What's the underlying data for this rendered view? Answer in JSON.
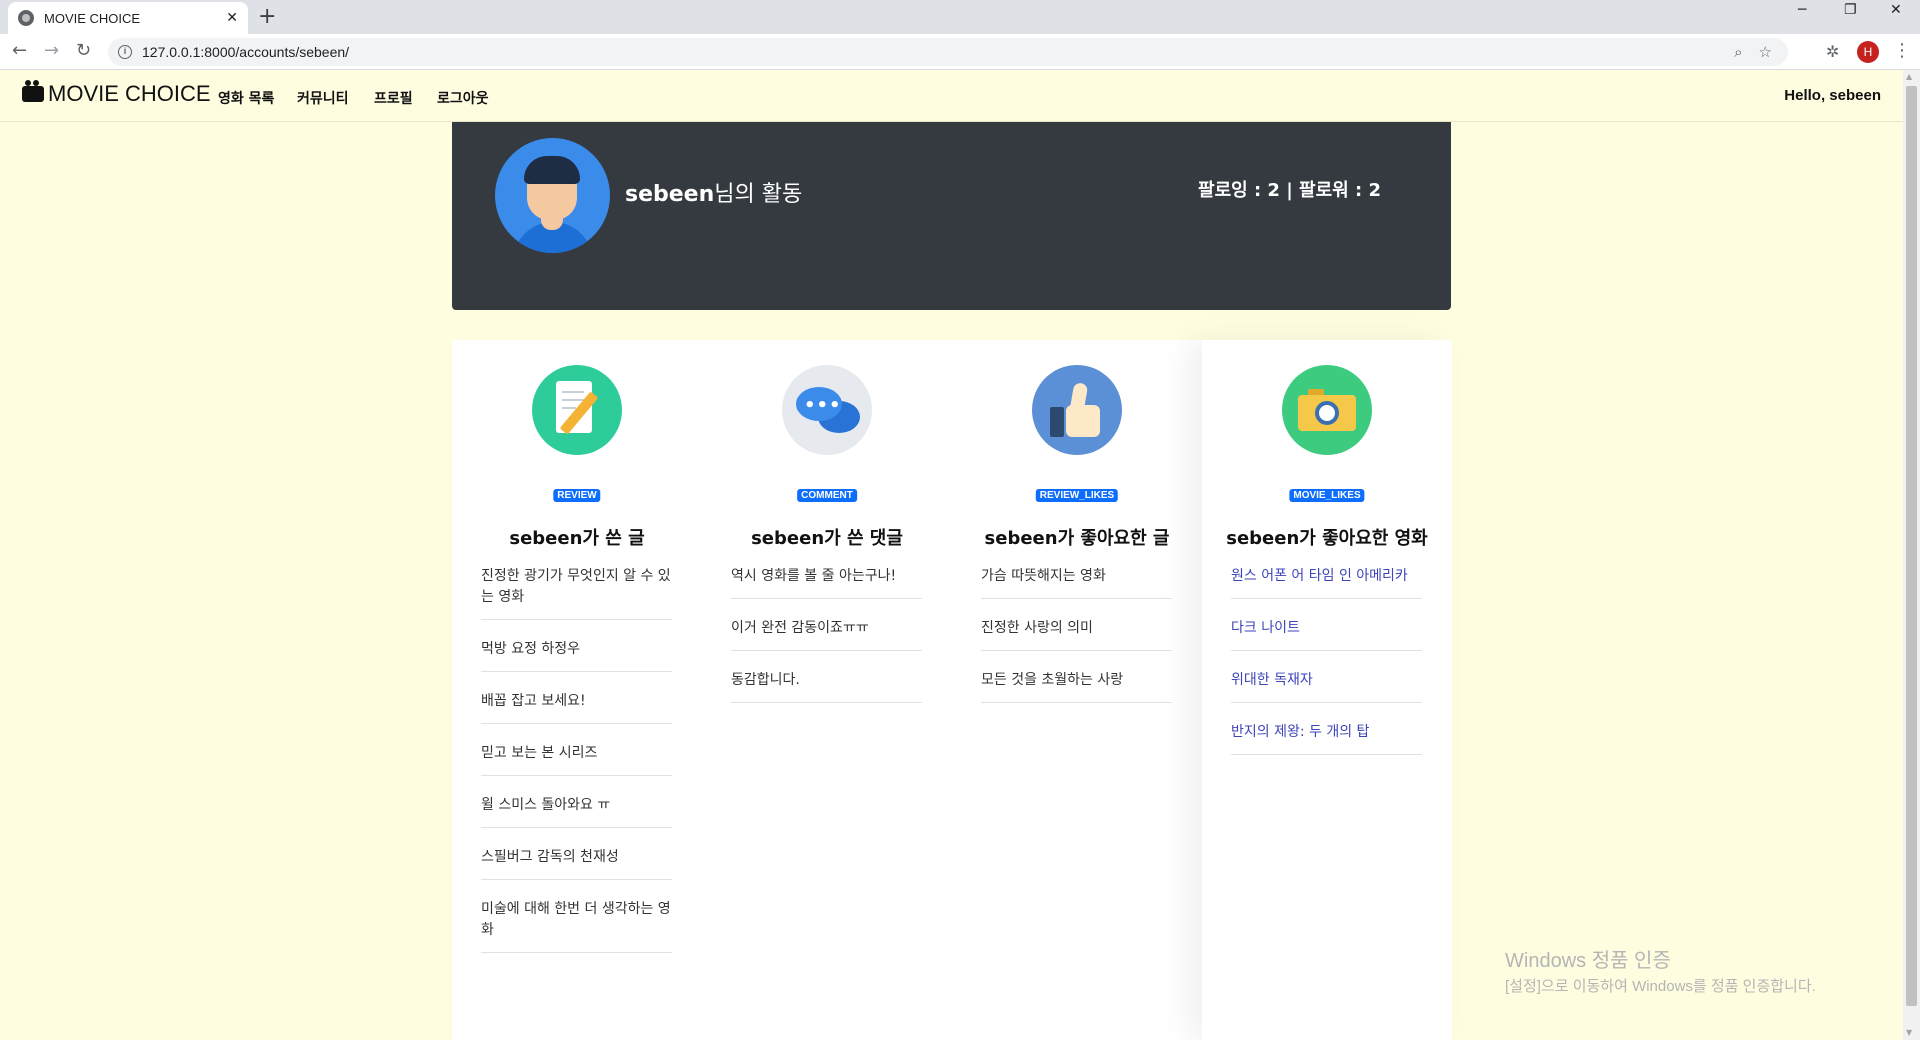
{
  "browser": {
    "tab_title": "MOVIE CHOICE",
    "tab_close": "✕",
    "new_tab": "+",
    "url": "127.0.0.1:8000/accounts/sebeen/",
    "profile_initial": "H",
    "window_controls": [
      "─",
      "❐",
      "✕"
    ],
    "nav_icons": [
      "back-icon",
      "forward-icon",
      "reload-icon"
    ]
  },
  "nav": {
    "brand": "MOVIE CHOICE",
    "links": [
      "영화 목록",
      "커뮤니티",
      "프로필",
      "로그아웃"
    ],
    "greeting": "Hello, sebeen"
  },
  "profile": {
    "username": "sebeen",
    "suffix": "님의 활동",
    "follow_text": "팔로잉 : 2 | 팔로워 : 2"
  },
  "columns": [
    {
      "badge": "REVIEW",
      "title": "sebeen가 쓴 글",
      "items": [
        "진정한 광기가 무엇인지 알 수 있는 영화",
        "먹방 요정 하정우",
        "배꼽 잡고 보세요!",
        "믿고 보는 본 시리즈",
        "윌 스미스 돌아와요 ㅠ",
        "스필버그 감독의 천재성",
        "미술에 대해 한번 더 생각하는 영화"
      ]
    },
    {
      "badge": "COMMENT",
      "title": "sebeen가 쓴 댓글",
      "items": [
        "역시 영화를 볼 줄 아는구나!",
        "이거 완전 감동이죠ㅠㅠ",
        "동감합니다."
      ]
    },
    {
      "badge": "REVIEW_LIKES",
      "title": "sebeen가 좋아요한 글",
      "items": [
        "가슴 따뜻해지는 영화",
        "진정한 사랑의 의미",
        "모든 것을 초월하는 사랑"
      ]
    },
    {
      "badge": "MOVIE_LIKES",
      "title": "sebeen가 좋아요한 영화",
      "items": [
        "원스 어폰 어 타임 인 아메리카",
        "다크 나이트",
        "위대한 독재자",
        "반지의 제왕: 두 개의 탑"
      ]
    }
  ],
  "watermark": {
    "line1": "Windows 정품 인증",
    "line2": "[설정]으로 이동하여 Windows를 정품 인증합니다."
  }
}
